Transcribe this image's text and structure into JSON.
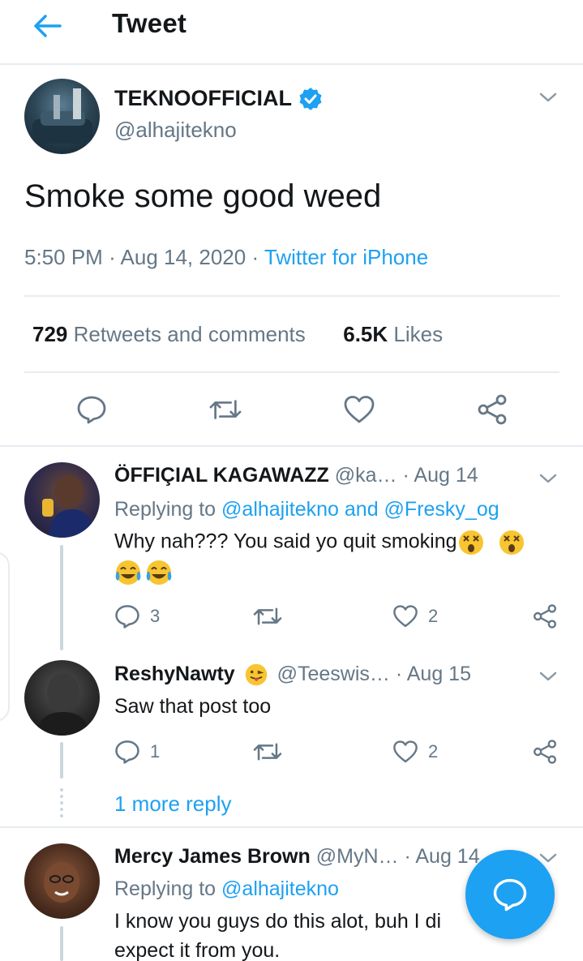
{
  "header": {
    "title": "Tweet",
    "back_icon": "arrow-left-icon"
  },
  "tweet": {
    "name": "TEKNOOFFICIAL",
    "handle": "@alhajitekno",
    "text": "Smoke some good weed",
    "time": "5:50 PM",
    "date": "Aug 14, 2020",
    "source": "Twitter for iPhone",
    "retweets_count": "729",
    "retweets_label": "Retweets and comments",
    "likes_count": "6.5K",
    "likes_label": "Likes"
  },
  "replies": [
    {
      "name": "ÖFFIÇIAL KAGAWAZZ",
      "handle": "@ka…",
      "date": "Aug 14",
      "replying_prefix": "Replying to",
      "replying_users": "@alhajitekno and @Fresky_og",
      "text": "Why nah??? You said yo quit smoking",
      "reply_count": "3",
      "like_count": "2"
    },
    {
      "name": "ReshyNawty",
      "handle": "@Teeswis…",
      "date": "Aug 15",
      "text": "Saw that post too",
      "reply_count": "1",
      "like_count": "2"
    },
    {
      "name": "Mercy James Brown",
      "handle": "@MyN…",
      "date": "Aug 14",
      "replying_prefix": "Replying to",
      "replying_users": "@alhajitekno",
      "text_line1": "I know you guys do this alot, buh I di",
      "text_line2": "expect it from you."
    }
  ],
  "more_replies": "1 more reply",
  "colors": {
    "accent": "#1da1f2",
    "muted": "#657786",
    "text": "#14171a",
    "divider": "#e6ecf0"
  }
}
